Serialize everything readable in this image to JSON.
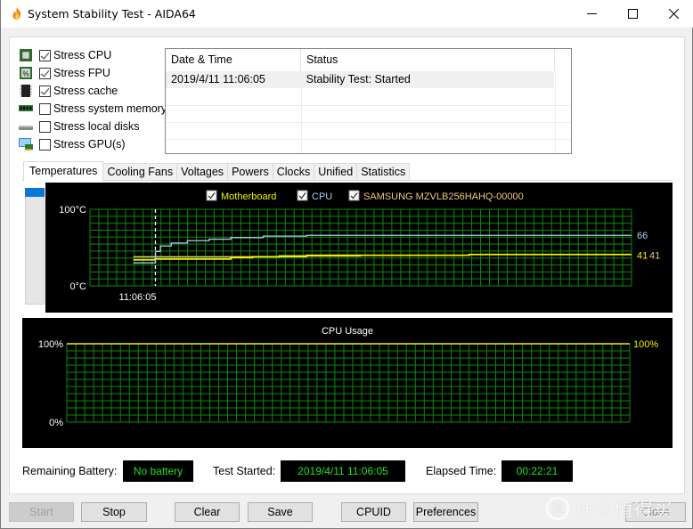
{
  "window": {
    "title": "System Stability Test - AIDA64",
    "controls": {
      "minimize": "minimize",
      "maximize": "maximize",
      "close": "close"
    }
  },
  "stress_options": [
    {
      "label": "Stress CPU",
      "checked": true,
      "icon": "cpu-chip-icon"
    },
    {
      "label": "Stress FPU",
      "checked": true,
      "icon": "fpu-chip-icon"
    },
    {
      "label": "Stress cache",
      "checked": true,
      "icon": "cache-chip-icon"
    },
    {
      "label": "Stress system memory",
      "checked": false,
      "icon": "memory-module-icon"
    },
    {
      "label": "Stress local disks",
      "checked": false,
      "icon": "disk-drive-icon"
    },
    {
      "label": "Stress GPU(s)",
      "checked": false,
      "icon": "gpu-monitor-icon"
    }
  ],
  "log": {
    "columns": [
      "Date & Time",
      "Status"
    ],
    "rows": [
      {
        "datetime": "2019/4/11 11:06:05",
        "status": "Stability Test: Started"
      }
    ]
  },
  "tabs": [
    {
      "label": "Temperatures",
      "active": true
    },
    {
      "label": "Cooling Fans",
      "active": false
    },
    {
      "label": "Voltages",
      "active": false
    },
    {
      "label": "Powers",
      "active": false
    },
    {
      "label": "Clocks",
      "active": false
    },
    {
      "label": "Unified",
      "active": false
    },
    {
      "label": "Statistics",
      "active": false
    }
  ],
  "temperature_panel": {
    "side_bar_level": 0.08
  },
  "chart_data": [
    {
      "type": "line",
      "title": "",
      "legend": [
        {
          "name": "Motherboard",
          "checked": true,
          "color": "#f2f200"
        },
        {
          "name": "CPU",
          "checked": true,
          "color": "#a8cdf0"
        },
        {
          "name": "SAMSUNG MZVLB256HAHQ-00000",
          "checked": true,
          "color": "#f0c878"
        }
      ],
      "ylim": [
        0,
        100
      ],
      "ytick_labels": {
        "top": "100°C",
        "bottom": "0°C"
      },
      "x_marker_label": "11:06:05",
      "x_marker_position": 0.12,
      "grid": true,
      "current_values": [
        {
          "series": "CPU",
          "value": "66",
          "color": "#a8cdf0"
        },
        {
          "series": "Motherboard",
          "value": "41",
          "color": "#f2f200"
        },
        {
          "series": "SAMSUNG MZVLB256HAHQ-00000",
          "value": "41",
          "color": "#f0c878"
        }
      ],
      "series": [
        {
          "name": "CPU",
          "color": "#a8cdf0",
          "x": [
            0.08,
            0.12,
            0.121,
            0.13,
            0.15,
            0.18,
            0.22,
            0.26,
            0.32,
            0.4,
            0.5,
            0.6,
            0.7,
            0.8,
            0.9,
            1.0
          ],
          "values": [
            30,
            30,
            45,
            52,
            56,
            59,
            61,
            63,
            65,
            66,
            66,
            66,
            66,
            66,
            66,
            66
          ]
        },
        {
          "name": "Motherboard",
          "color": "#f2f200",
          "x": [
            0.08,
            0.12,
            0.2,
            0.26,
            0.3,
            0.35,
            0.4,
            0.5,
            0.6,
            0.7,
            0.8,
            0.9,
            1.0
          ],
          "values": [
            34,
            35,
            35,
            37,
            38,
            39,
            40,
            40,
            40,
            41,
            41,
            41,
            41
          ]
        },
        {
          "name": "SAMSUNG MZVLB256HAHQ-00000",
          "color": "#f0c878",
          "x": [
            0.08,
            0.12,
            0.2,
            0.3,
            0.4,
            0.5,
            0.6,
            0.7,
            0.8,
            0.9,
            1.0
          ],
          "values": [
            38,
            38,
            38,
            38,
            39,
            40,
            40,
            41,
            41,
            41,
            41
          ]
        }
      ]
    },
    {
      "type": "line",
      "title": "CPU Usage",
      "ylim": [
        0,
        100
      ],
      "ytick_labels": {
        "top": "100%",
        "bottom": "0%"
      },
      "grid": true,
      "current_values": [
        {
          "series": "CPU Usage",
          "value": "100%",
          "color": "#f2f200"
        }
      ],
      "series": [
        {
          "name": "CPU Usage",
          "color": "#f2f200",
          "x": [
            0,
            1
          ],
          "values": [
            100,
            100
          ]
        }
      ]
    }
  ],
  "status": {
    "battery_label": "Remaining Battery:",
    "battery_value": "No battery",
    "started_label": "Test Started:",
    "started_value": "2019/4/11 11:06:05",
    "elapsed_label": "Elapsed Time:",
    "elapsed_value": "00:22:21"
  },
  "buttons": {
    "start": "Start",
    "stop": "Stop",
    "clear": "Clear",
    "save": "Save",
    "cpuid": "CPUID",
    "preferences": "Preferences",
    "close": "Close"
  },
  "watermark": {
    "badge": "值",
    "text": "什么值得买"
  }
}
